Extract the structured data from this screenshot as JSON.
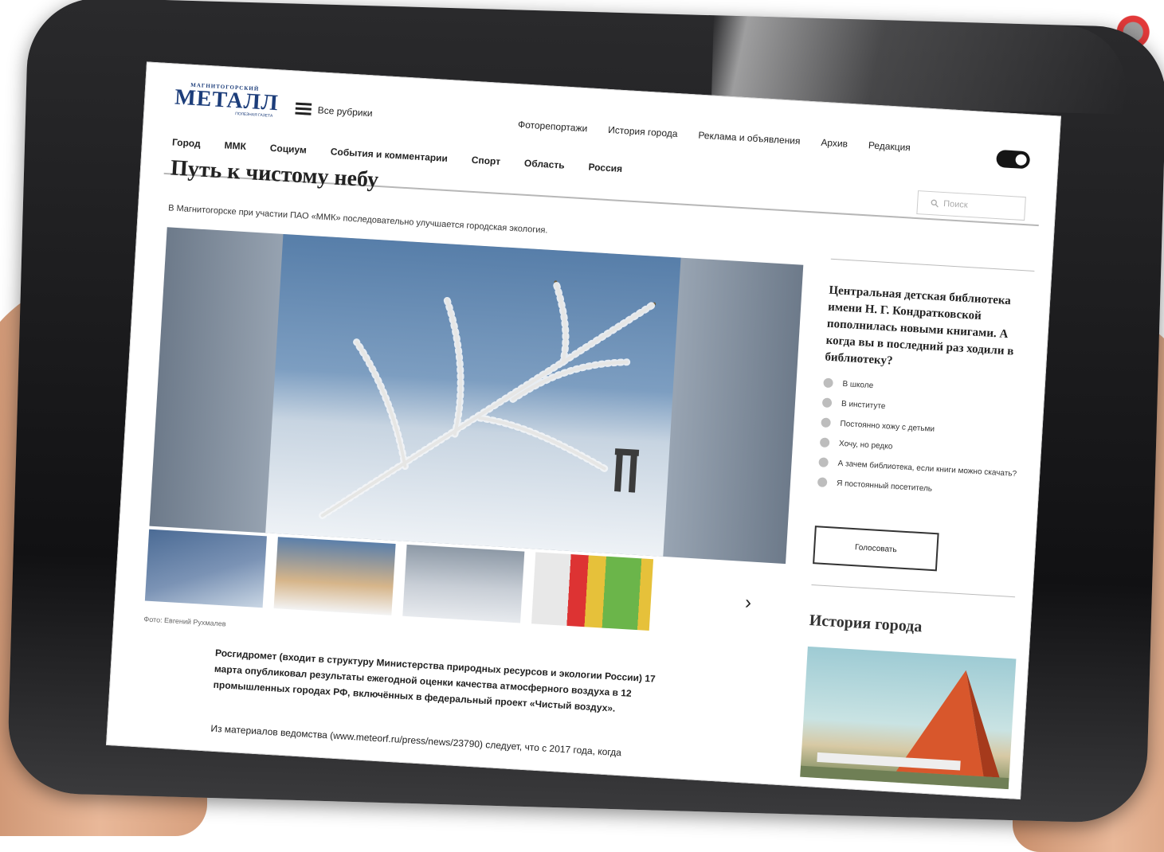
{
  "logo": {
    "top": "МАГНИТОГОРСКИЙ",
    "name": "МЕТАЛЛ",
    "small": "ПОЛЕЗНАЯ ГАЗЕТА"
  },
  "header": {
    "all_rubrics": "Все рубрики",
    "nav": [
      "Фоторепортажи",
      "История города",
      "Реклама и объявления",
      "Архив",
      "Редакция"
    ]
  },
  "categories": [
    "Город",
    "ММК",
    "Социум",
    "События и комментарии",
    "Спорт",
    "Область",
    "Россия"
  ],
  "search": {
    "placeholder": "Поиск"
  },
  "article": {
    "title": "Путь к чистому небу",
    "lead": "В Магнитогорске при участии ПАО «ММК» последовательно улучшается городская экология.",
    "photo_credit": "Фото: Евгений Рухмалев",
    "body_bold": "Росгидромет (входит в структуру Министерства природных ресурсов и экологии России) 17 марта опубликовал результаты ежегодной оценки качества атмосферного воздуха в 12 промышленных городах РФ, включённых в федеральный проект «Чистый воздух».",
    "body_text": "Из материалов ведомства (www.meteorf.ru/press/news/23790) следует, что с 2017 года, когда"
  },
  "thumbnails": [
    "thumb-frost-branch",
    "thumb-sunlit-tree",
    "thumb-winter-park",
    "thumb-air-quality-table"
  ],
  "poll": {
    "question": "Центральная детская библиотека имени Н. Г. Кондратковской пополнилась новыми книгами. А когда вы в последний раз ходили в библиотеку?",
    "options": [
      "В школе",
      "В институте",
      "Постоянно хожу с детьми",
      "Хочу, но редко",
      "А зачем библиотека, если книги можно скачать?",
      "Я постоянный посетитель"
    ],
    "vote_label": "Голосовать"
  },
  "sidebar": {
    "history_title": "История города"
  },
  "icons": {
    "menu": "menu-icon",
    "search": "search-icon",
    "next": "chevron-right-icon",
    "toggle": "theme-toggle"
  },
  "colors": {
    "logo_blue": "#1c3d7a",
    "toggle_dark": "#151515",
    "tablet_bezel": "#1a1a1c"
  }
}
